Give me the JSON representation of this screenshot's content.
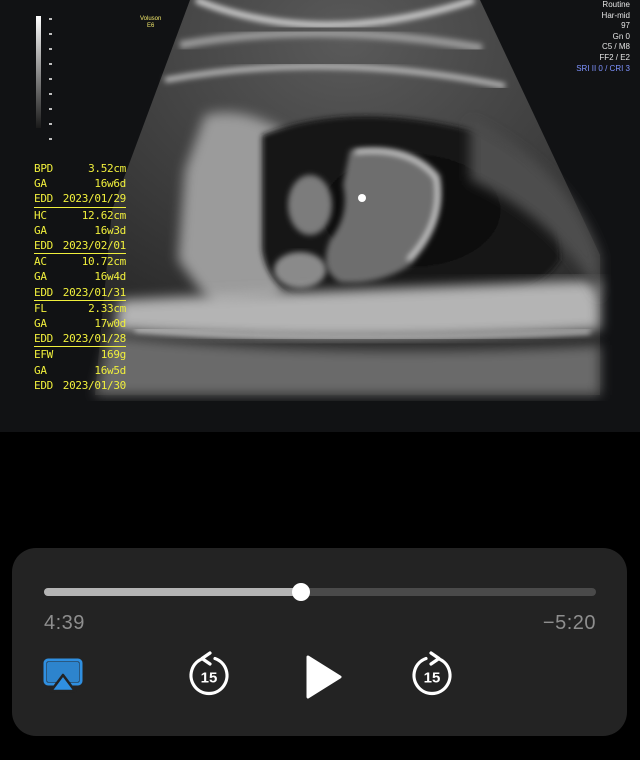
{
  "video": {
    "probe_label": [
      "Voluson",
      "E6"
    ],
    "settings": [
      "Routine",
      "Har-mid",
      "97",
      "Gn  0",
      "C5 / M8",
      "FF2 / E2"
    ],
    "settings_highlight": "SRI II 0 / CRI 3",
    "measurements": [
      [
        [
          "BPD",
          "3.52cm"
        ],
        [
          "GA",
          "16w6d"
        ],
        [
          "EDD",
          "2023/01/29"
        ]
      ],
      [
        [
          "HC",
          "12.62cm"
        ],
        [
          "GA",
          "16w3d"
        ],
        [
          "EDD",
          "2023/02/01"
        ]
      ],
      [
        [
          "AC",
          "10.72cm"
        ],
        [
          "GA",
          "16w4d"
        ],
        [
          "EDD",
          "2023/01/31"
        ]
      ],
      [
        [
          "FL",
          "2.33cm"
        ],
        [
          "GA",
          "17w0d"
        ],
        [
          "EDD",
          "2023/01/28"
        ]
      ],
      [
        [
          "EFW",
          "169g"
        ],
        [
          "GA",
          "16w5d"
        ],
        [
          "EDD",
          "2023/01/30"
        ]
      ]
    ]
  },
  "player": {
    "progress": 0.466,
    "elapsed": "4:39",
    "remaining": "−5:20",
    "skip_back_seconds": "15",
    "skip_forward_seconds": "15",
    "icons": {
      "airplay": "airplay-icon",
      "skip_back": "skip-back-15-icon",
      "play": "play-icon",
      "skip_forward": "skip-forward-15-icon"
    },
    "colors": {
      "airplay": "#2f8fe0",
      "controls": "#ffffff",
      "time": "#8e8e8e"
    }
  }
}
